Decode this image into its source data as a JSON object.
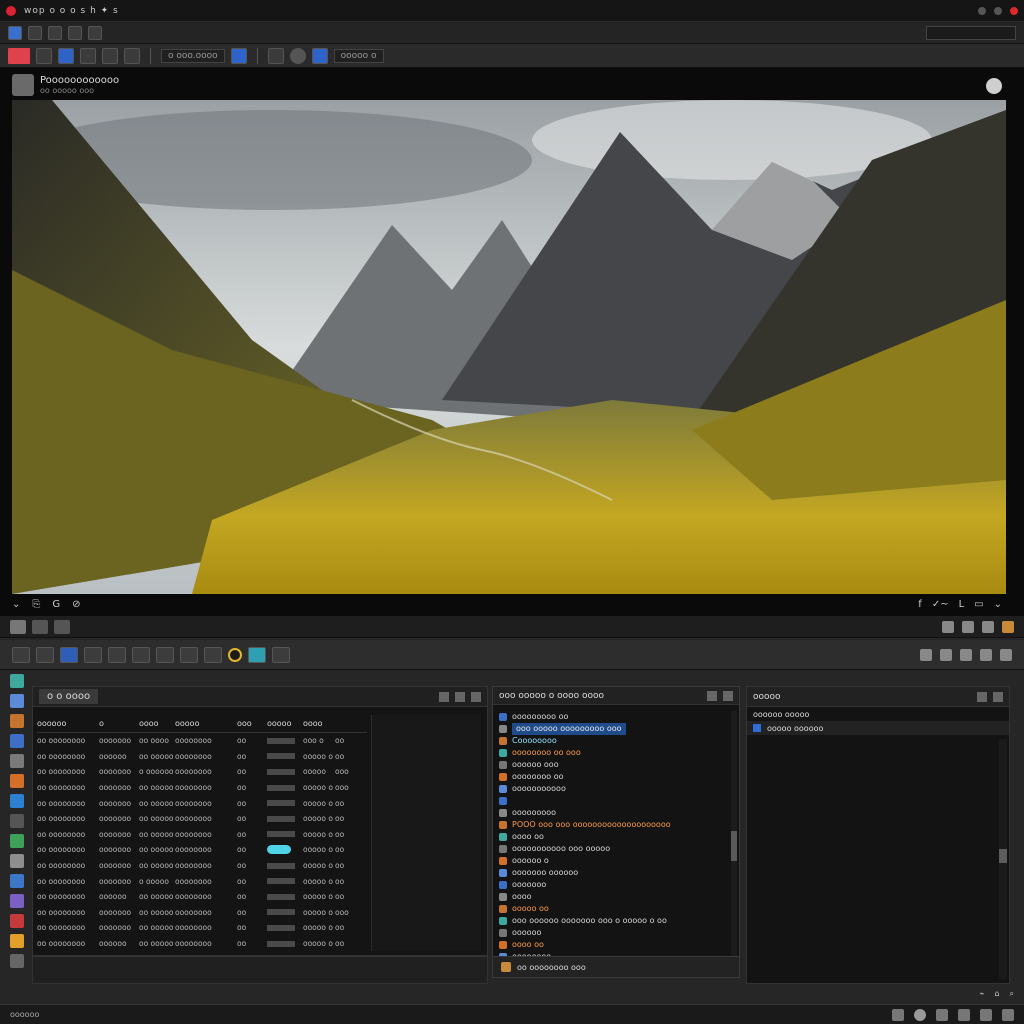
{
  "window": {
    "title": "wop o o o s h  ✦ s"
  },
  "menubar": {
    "field": ""
  },
  "toolbar": {
    "label_a": "o ooo.oooo",
    "label_b": "ooooo o"
  },
  "viewer": {
    "title": "Poooooooooooo",
    "subtitle": "oo ooooo ooo",
    "footer_left": [
      "⌄",
      "⎘",
      "G",
      "⊘"
    ],
    "footer_right": [
      "f",
      "✓~",
      "L",
      "▭",
      "⌄"
    ]
  },
  "browser": {
    "tab_label": "o o oooo",
    "columns": [
      "oooooo",
      "o",
      "oooo",
      "ooooo",
      "ooo",
      "ooooo",
      "oooo",
      ""
    ],
    "rows": [
      [
        "oo oooooooo",
        "ooooooo",
        "oo oooo",
        "oooooooo",
        "oo",
        "",
        "ooo o",
        "oo"
      ],
      [
        "oo oooooooo",
        "oooooo",
        "oo ooooo",
        "oooooooo",
        "oo",
        "",
        "ooooo o",
        "oo"
      ],
      [
        "oo oooooooo",
        "ooooooo",
        "o oooooo",
        "oooooooo",
        "oo",
        "",
        "ooooo",
        "ooo"
      ],
      [
        "oo oooooooo",
        "ooooooo",
        "oo ooooo",
        "oooooooo",
        "oo",
        "",
        "ooooo o",
        "ooo"
      ],
      [
        "oo oooooooo",
        "ooooooo",
        "oo ooooo",
        "oooooooo",
        "oo",
        "",
        "ooooo o",
        "oo"
      ],
      [
        "oo oooooooo",
        "ooooooo",
        "oo ooooo",
        "oooooooo",
        "oo",
        "",
        "ooooo o",
        "oo"
      ],
      [
        "oo oooooooo",
        "ooooooo",
        "oo ooooo",
        "oooooooo",
        "oo",
        "",
        "ooooo o",
        "oo"
      ],
      [
        "oo oooooooo",
        "ooooooo",
        "oo ooooo",
        "oooooooo",
        "oo",
        "",
        "ooooo o",
        "oo"
      ],
      [
        "oo oooooooo",
        "ooooooo",
        "oo ooooo",
        "oooooooo",
        "oo",
        "",
        "ooooo o",
        "oo"
      ],
      [
        "oo oooooooo",
        "ooooooo",
        "o ooooo",
        "oooooooo",
        "oo",
        "",
        "ooooo o",
        "oo"
      ],
      [
        "oo oooooooo",
        "oooooo",
        "oo ooooo",
        "oooooooo",
        "oo",
        "",
        "ooooo o",
        "oo"
      ],
      [
        "oo oooooooo",
        "ooooooo",
        "oo ooooo",
        "oooooooo",
        "oo",
        "",
        "ooooo o",
        "ooo"
      ],
      [
        "oo oooooooo",
        "ooooooo",
        "oo ooooo",
        "oooooooo",
        "oo",
        "",
        "ooooo o",
        "oo"
      ],
      [
        "oo oooooooo",
        "oooooo",
        "oo ooooo",
        "oooooooo",
        "oo",
        "",
        "ooooo o",
        "oo"
      ],
      [
        "oo oooooooo",
        "ooooooo",
        "oo ooooo",
        "oooooooo",
        "oo",
        "",
        "ooooo o",
        "oo"
      ]
    ]
  },
  "log": {
    "title": "ooo ooooo o oooo oooo",
    "lines": [
      {
        "text": "ooooooooo oo",
        "style": ""
      },
      {
        "text": "ooo ooooo  ooooooooo ooo",
        "style": "hl"
      },
      {
        "text": "Coooooooo",
        "style": "cyan"
      },
      {
        "text": "oooooooo oo  ooo",
        "style": "orange"
      },
      {
        "text": "oooooo ooo",
        "style": ""
      },
      {
        "text": "oooooooo oo",
        "style": ""
      },
      {
        "text": "ooooooooooo",
        "style": ""
      },
      {
        "text": "",
        "style": ""
      },
      {
        "text": "ooooooooo",
        "style": ""
      },
      {
        "text": "POOO ooo ooo oooooooooooooooooooo",
        "style": "orange"
      },
      {
        "text": "oooo oo",
        "style": ""
      },
      {
        "text": "ooooooooooo ooo ooooo",
        "style": ""
      },
      {
        "text": "oooooo o",
        "style": ""
      },
      {
        "text": "ooooooo oooooo",
        "style": ""
      },
      {
        "text": "ooooooo",
        "style": ""
      },
      {
        "text": "oooo",
        "style": ""
      },
      {
        "text": "ooooo oo",
        "style": "orange"
      },
      {
        "text": "ooo oooooo ooooooo ooo o ooooo o oo",
        "style": ""
      },
      {
        "text": "oooooo",
        "style": ""
      },
      {
        "text": "oooo oo",
        "style": "orange"
      },
      {
        "text": "oooooooo",
        "style": ""
      }
    ],
    "footer": "oo oooooooo ooo"
  },
  "props": {
    "title": "ooooo",
    "rows": [
      "oooooo ooooo",
      "ooooo oooooo"
    ]
  },
  "lower_status": {
    "items": [
      "⌁",
      "⌂",
      "⌕"
    ]
  },
  "status": {
    "text": "oooooo"
  },
  "colors": {
    "accent": "#2f63c9",
    "danger": "#e0424c",
    "highlight": "#4fd3e6"
  }
}
